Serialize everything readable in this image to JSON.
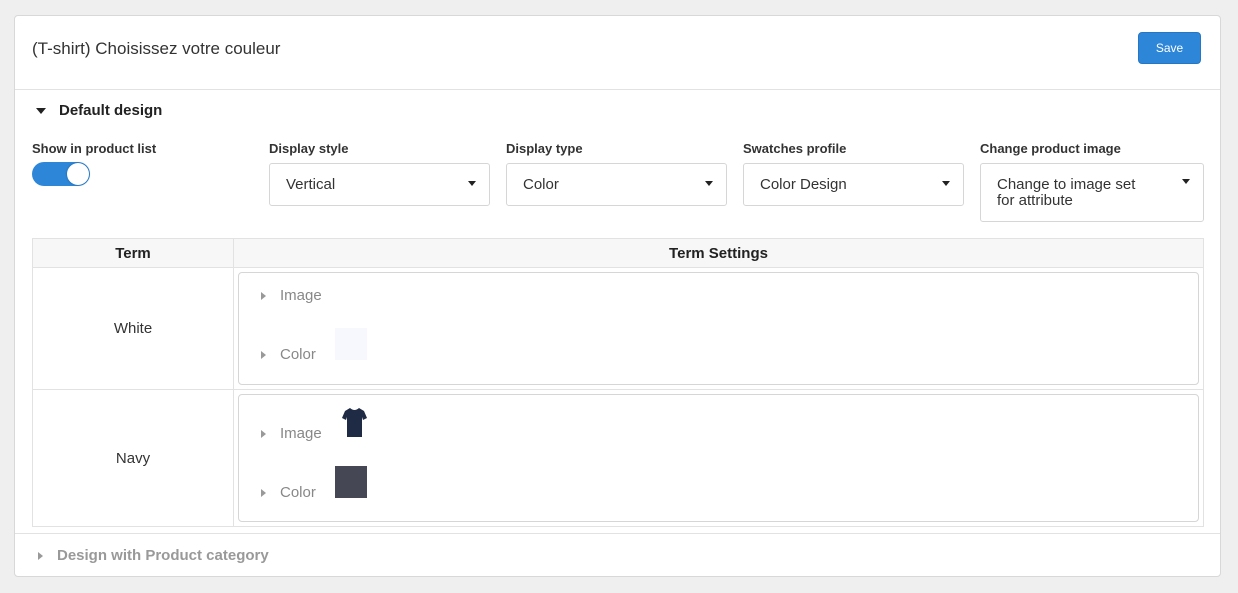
{
  "header": {
    "title": "(T-shirt) Choisissez votre couleur",
    "save_label": "Save"
  },
  "default_design": {
    "title": "Default design",
    "show_in_product_list": {
      "label": "Show in product list",
      "enabled": true
    },
    "display_style": {
      "label": "Display style",
      "value": "Vertical"
    },
    "display_type": {
      "label": "Display type",
      "value": "Color"
    },
    "swatches_profile": {
      "label": "Swatches profile",
      "value": "Color Design"
    },
    "change_product_image": {
      "label": "Change product image",
      "value": "Change to image set for attribute"
    }
  },
  "table": {
    "headers": [
      "Term",
      "Term Settings"
    ],
    "rows": [
      {
        "term": "White",
        "image_label": "Image",
        "color_label": "Color",
        "color": "#f7f8fd",
        "has_image": false
      },
      {
        "term": "Navy",
        "image_label": "Image",
        "color_label": "Color",
        "color": "#454754",
        "has_image": true,
        "image_icon": "navy-tshirt-icon"
      }
    ]
  },
  "footer": {
    "label": "Design with Product category"
  },
  "colors": {
    "accent": "#2d86d8",
    "navy_shirt": "#1f2a44"
  }
}
